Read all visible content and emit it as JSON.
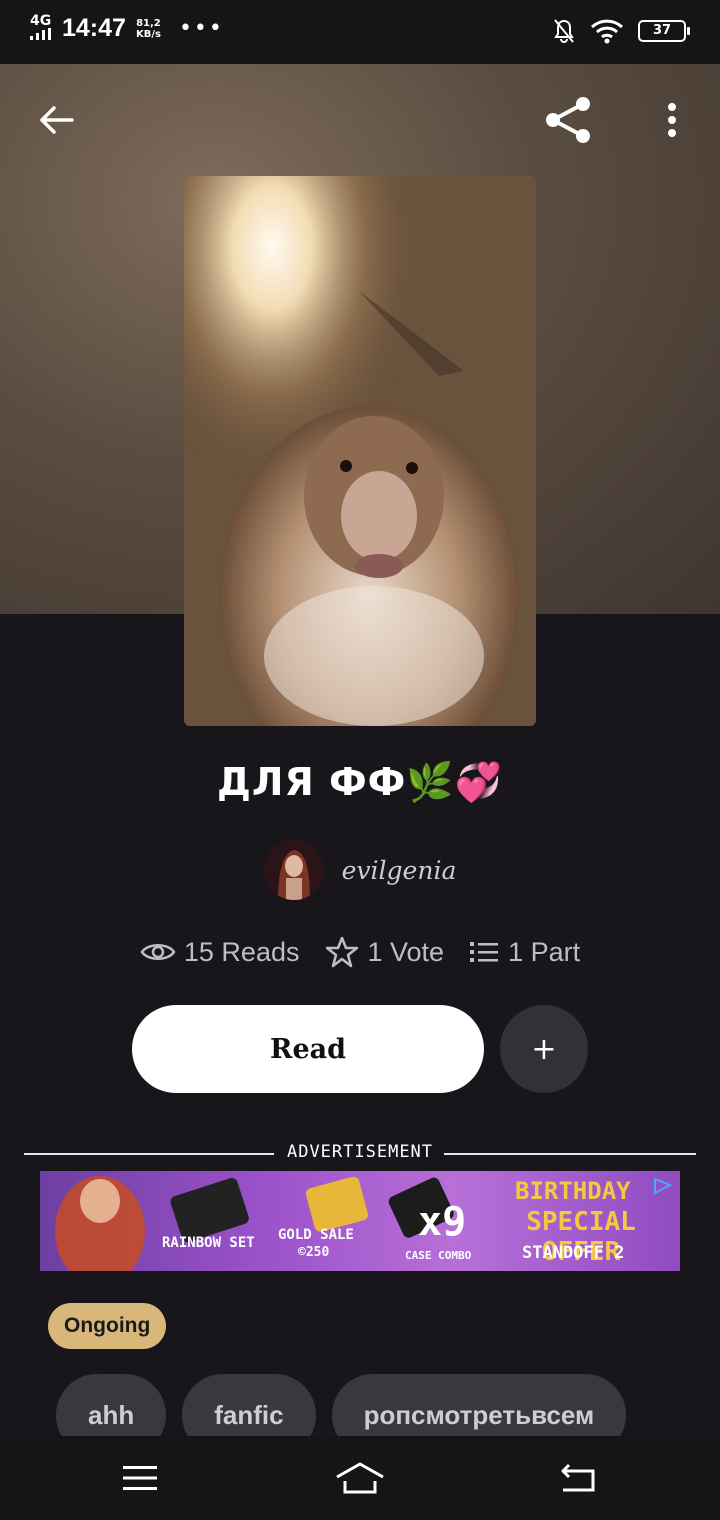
{
  "status_bar": {
    "network": "4G",
    "time": "14:47",
    "speed_value": "81,2",
    "speed_unit": "KB/s",
    "more": "•••",
    "battery": "37"
  },
  "story": {
    "title": "ДЛЯ ФФ🌿💞",
    "author": "evilgenia",
    "reads": "15 Reads",
    "votes": "1 Vote",
    "parts": "1 Part",
    "status": "Ongoing"
  },
  "actions": {
    "read_label": "Read",
    "add_label": "+"
  },
  "ad": {
    "label": "ADVERTISEMENT",
    "items": [
      "RAINBOW SET",
      "GOLD SALE",
      "©250",
      "x9",
      "CASE COMBO",
      "BIRTHDAY",
      "SPECIAL OFFER",
      "STANDOFF 2"
    ]
  },
  "tags": [
    "ahh",
    "fanfic",
    "ропсмотретьвсем"
  ],
  "colors": {
    "background": "#18161a",
    "badge": "#d9b77a",
    "tag_bg": "#3a383c",
    "ad_purple": "#9b52c9"
  }
}
